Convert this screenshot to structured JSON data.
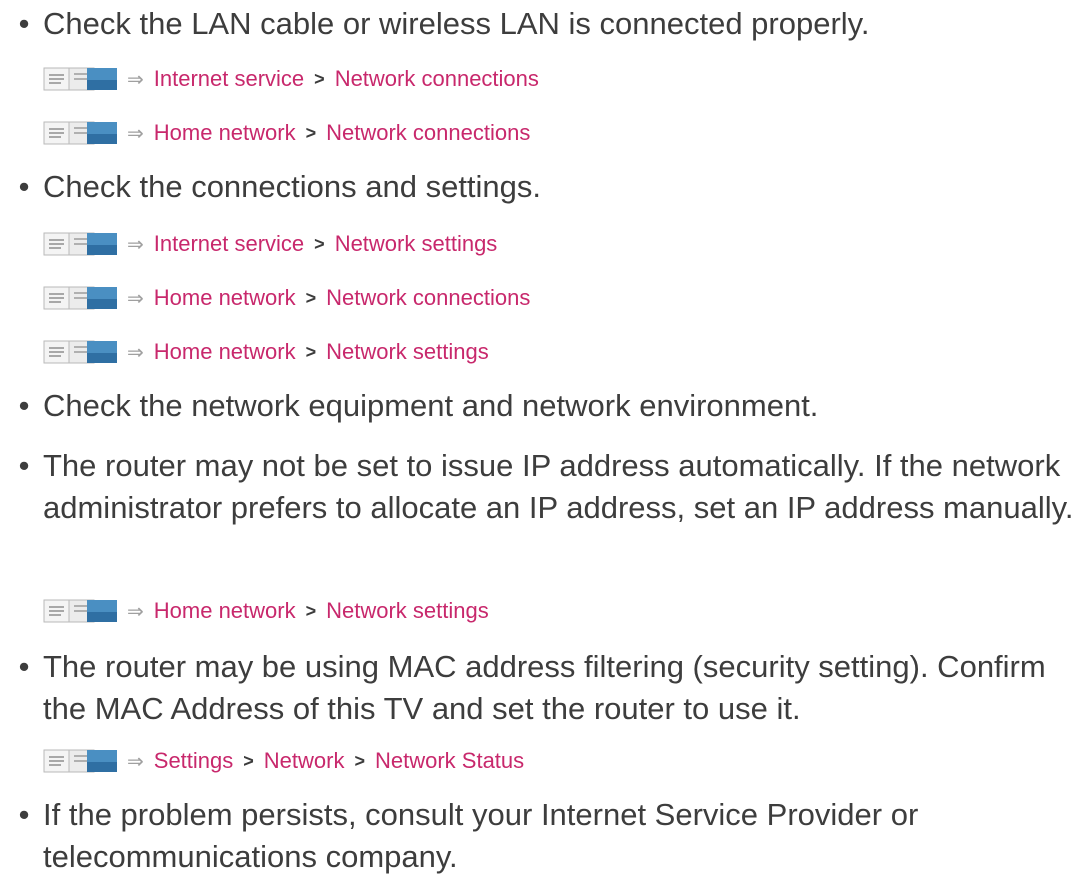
{
  "bullets": [
    {
      "dot": "•",
      "text": "Check the LAN cable or wireless LAN is connected properly."
    },
    {
      "dot": "•",
      "text": "Check the connections and settings."
    },
    {
      "dot": "•",
      "text": "Check the network equipment and network environment."
    },
    {
      "dot": "•",
      "text": "The router may not be set to issue IP address automatically. If the network administrator prefers to allocate an IP address, set an IP address manually."
    },
    {
      "dot": "•",
      "text": "The router may be using MAC address filtering (security setting). Confirm the MAC Address of this TV and set the router to use it."
    },
    {
      "dot": "•",
      "text": "If the problem persists, consult your Internet Service Provider or telecommunications company."
    }
  ],
  "refs": [
    {
      "arrow": "⇒",
      "sep": ">",
      "a": "Internet service",
      "b": "Network connections"
    },
    {
      "arrow": "⇒",
      "sep": ">",
      "a": "Home network",
      "b": "Network connections"
    },
    {
      "arrow": "⇒",
      "sep": ">",
      "a": "Internet service",
      "b": "Network settings"
    },
    {
      "arrow": "⇒",
      "sep": ">",
      "a": "Home network",
      "b": "Network connections"
    },
    {
      "arrow": "⇒",
      "sep": ">",
      "a": "Home network",
      "b": "Network settings"
    },
    {
      "arrow": "⇒",
      "sep": ">",
      "a": "Home network",
      "b": "Network settings"
    },
    {
      "arrow": "⇒",
      "sep": ">",
      "a": "Settings",
      "b": "Network",
      "c": "Network Status"
    }
  ],
  "colors": {
    "link": "#c8286c",
    "text": "#3d3d3d",
    "book_icon": "#4a8fc2"
  },
  "icons": {
    "reference": "book-icon",
    "arrow": "double-arrow-icon"
  }
}
